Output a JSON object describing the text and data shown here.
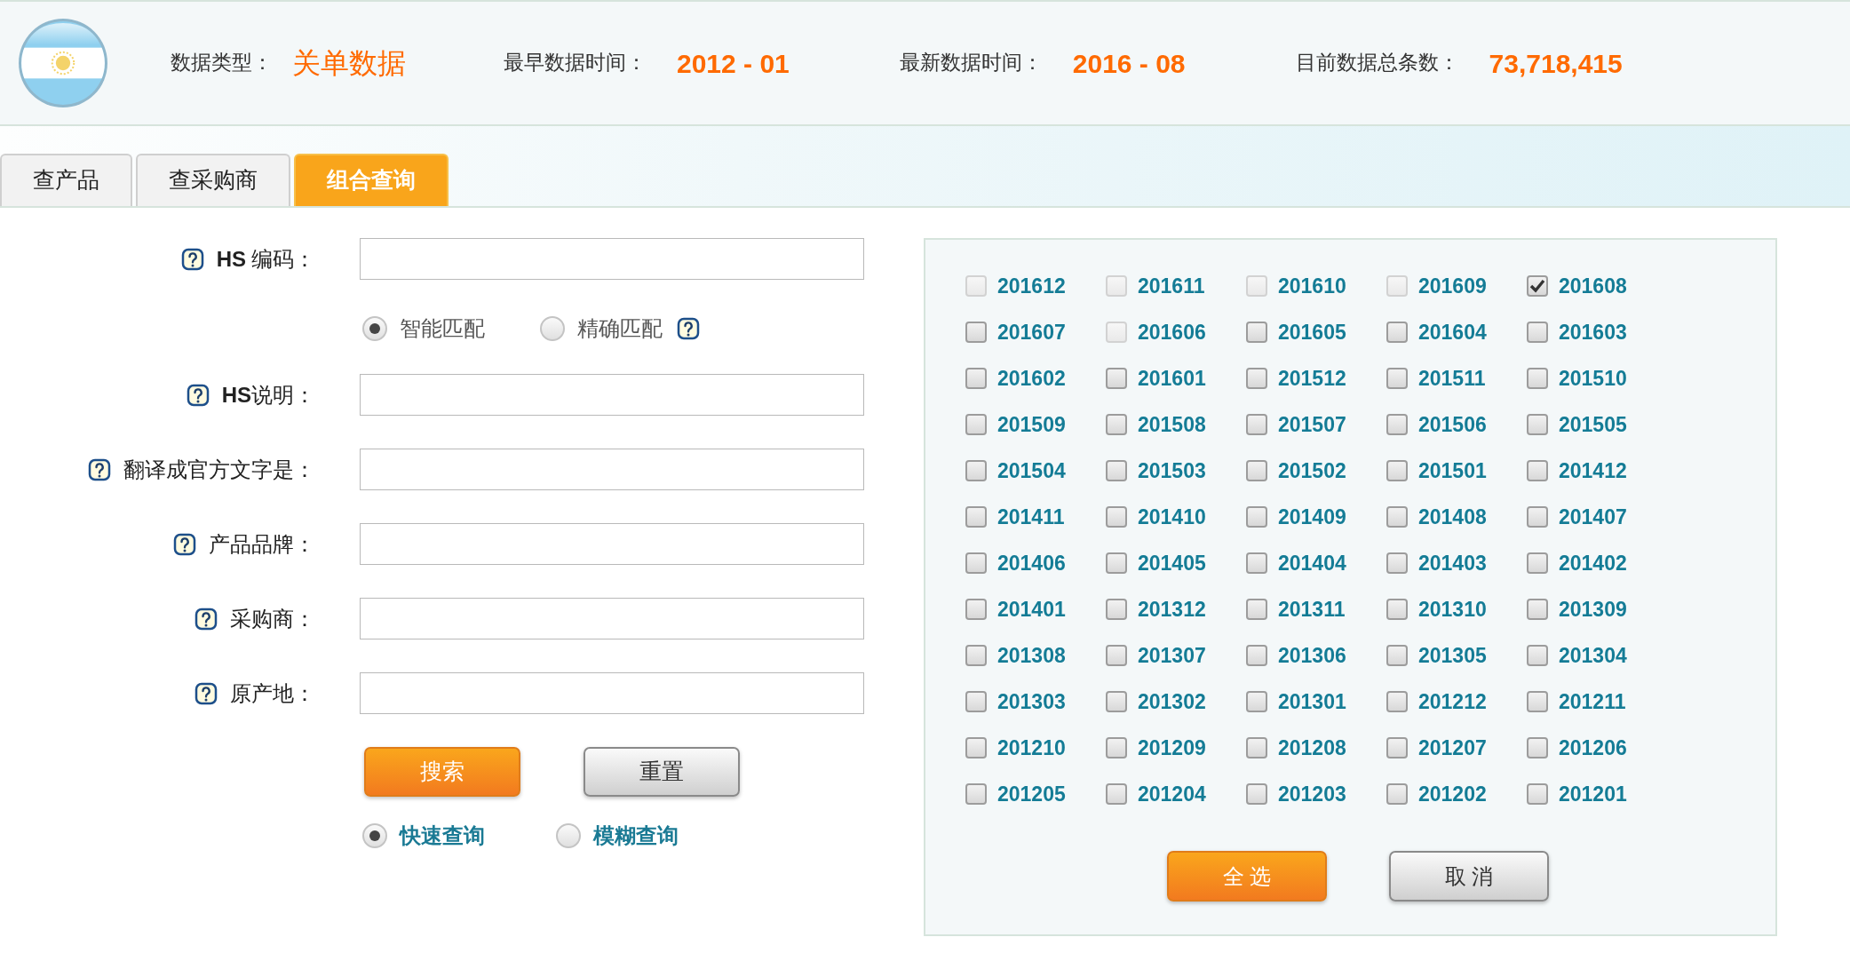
{
  "header": {
    "stats": [
      {
        "label": "数据类型：",
        "value": "关单数据",
        "kind": "text"
      },
      {
        "label": "最早数据时间：",
        "value": "2012 - 01",
        "kind": "number"
      },
      {
        "label": "最新数据时间：",
        "value": "2016 - 08",
        "kind": "number"
      },
      {
        "label": "目前数据总条数：",
        "value": "73,718,415",
        "kind": "number"
      }
    ]
  },
  "tabs": [
    {
      "label": "查产品",
      "selected": false
    },
    {
      "label": "查采购商",
      "selected": false
    },
    {
      "label": "组合查询",
      "selected": true
    }
  ],
  "form": {
    "rows": [
      {
        "kind": "field",
        "label": "**HS** 编码："
      },
      {
        "kind": "match",
        "options": [
          {
            "label": "智能匹配",
            "selected": true
          },
          {
            "label": "精确匹配",
            "selected": false
          }
        ]
      },
      {
        "kind": "field",
        "label": "**HS**说明："
      },
      {
        "kind": "field",
        "label": "翻译成官方文字是："
      },
      {
        "kind": "field",
        "label": "产品品牌："
      },
      {
        "kind": "field",
        "label": "采购商："
      },
      {
        "kind": "field",
        "label": "原产地："
      }
    ],
    "buttons": [
      {
        "label": "搜索",
        "kind": "primary"
      },
      {
        "label": "重置",
        "kind": "secondary"
      }
    ],
    "query_modes": [
      {
        "label": "快速查询",
        "selected": true
      },
      {
        "label": "模糊查询",
        "selected": false
      }
    ]
  },
  "months": [
    {
      "label": "201612",
      "checked": false,
      "disabled": true
    },
    {
      "label": "201611",
      "checked": false,
      "disabled": true
    },
    {
      "label": "201610",
      "checked": false,
      "disabled": true
    },
    {
      "label": "201609",
      "checked": false,
      "disabled": true
    },
    {
      "label": "201608",
      "checked": true,
      "disabled": false
    },
    {
      "label": "201607",
      "checked": false,
      "disabled": false
    },
    {
      "label": "201606",
      "checked": false,
      "disabled": true
    },
    {
      "label": "201605",
      "checked": false,
      "disabled": false
    },
    {
      "label": "201604",
      "checked": false,
      "disabled": false
    },
    {
      "label": "201603",
      "checked": false,
      "disabled": false
    },
    {
      "label": "201602",
      "checked": false,
      "disabled": false
    },
    {
      "label": "201601",
      "checked": false,
      "disabled": false
    },
    {
      "label": "201512",
      "checked": false,
      "disabled": false
    },
    {
      "label": "201511",
      "checked": false,
      "disabled": false
    },
    {
      "label": "201510",
      "checked": false,
      "disabled": false
    },
    {
      "label": "201509",
      "checked": false,
      "disabled": false
    },
    {
      "label": "201508",
      "checked": false,
      "disabled": false
    },
    {
      "label": "201507",
      "checked": false,
      "disabled": false
    },
    {
      "label": "201506",
      "checked": false,
      "disabled": false
    },
    {
      "label": "201505",
      "checked": false,
      "disabled": false
    },
    {
      "label": "201504",
      "checked": false,
      "disabled": false
    },
    {
      "label": "201503",
      "checked": false,
      "disabled": false
    },
    {
      "label": "201502",
      "checked": false,
      "disabled": false
    },
    {
      "label": "201501",
      "checked": false,
      "disabled": false
    },
    {
      "label": "201412",
      "checked": false,
      "disabled": false
    },
    {
      "label": "201411",
      "checked": false,
      "disabled": false
    },
    {
      "label": "201410",
      "checked": false,
      "disabled": false
    },
    {
      "label": "201409",
      "checked": false,
      "disabled": false
    },
    {
      "label": "201408",
      "checked": false,
      "disabled": false
    },
    {
      "label": "201407",
      "checked": false,
      "disabled": false
    },
    {
      "label": "201406",
      "checked": false,
      "disabled": false
    },
    {
      "label": "201405",
      "checked": false,
      "disabled": false
    },
    {
      "label": "201404",
      "checked": false,
      "disabled": false
    },
    {
      "label": "201403",
      "checked": false,
      "disabled": false
    },
    {
      "label": "201402",
      "checked": false,
      "disabled": false
    },
    {
      "label": "201401",
      "checked": false,
      "disabled": false
    },
    {
      "label": "201312",
      "checked": false,
      "disabled": false
    },
    {
      "label": "201311",
      "checked": false,
      "disabled": false
    },
    {
      "label": "201310",
      "checked": false,
      "disabled": false
    },
    {
      "label": "201309",
      "checked": false,
      "disabled": false
    },
    {
      "label": "201308",
      "checked": false,
      "disabled": false
    },
    {
      "label": "201307",
      "checked": false,
      "disabled": false
    },
    {
      "label": "201306",
      "checked": false,
      "disabled": false
    },
    {
      "label": "201305",
      "checked": false,
      "disabled": false
    },
    {
      "label": "201304",
      "checked": false,
      "disabled": false
    },
    {
      "label": "201303",
      "checked": false,
      "disabled": false
    },
    {
      "label": "201302",
      "checked": false,
      "disabled": false
    },
    {
      "label": "201301",
      "checked": false,
      "disabled": false
    },
    {
      "label": "201212",
      "checked": false,
      "disabled": false
    },
    {
      "label": "201211",
      "checked": false,
      "disabled": false
    },
    {
      "label": "201210",
      "checked": false,
      "disabled": false
    },
    {
      "label": "201209",
      "checked": false,
      "disabled": false
    },
    {
      "label": "201208",
      "checked": false,
      "disabled": false
    },
    {
      "label": "201207",
      "checked": false,
      "disabled": false
    },
    {
      "label": "201206",
      "checked": false,
      "disabled": false
    },
    {
      "label": "201205",
      "checked": false,
      "disabled": false
    },
    {
      "label": "201204",
      "checked": false,
      "disabled": false
    },
    {
      "label": "201203",
      "checked": false,
      "disabled": false
    },
    {
      "label": "201202",
      "checked": false,
      "disabled": false
    },
    {
      "label": "201201",
      "checked": false,
      "disabled": false
    }
  ],
  "month_buttons": [
    {
      "label": "全 选",
      "kind": "primary"
    },
    {
      "label": "取 消",
      "kind": "secondary"
    }
  ]
}
